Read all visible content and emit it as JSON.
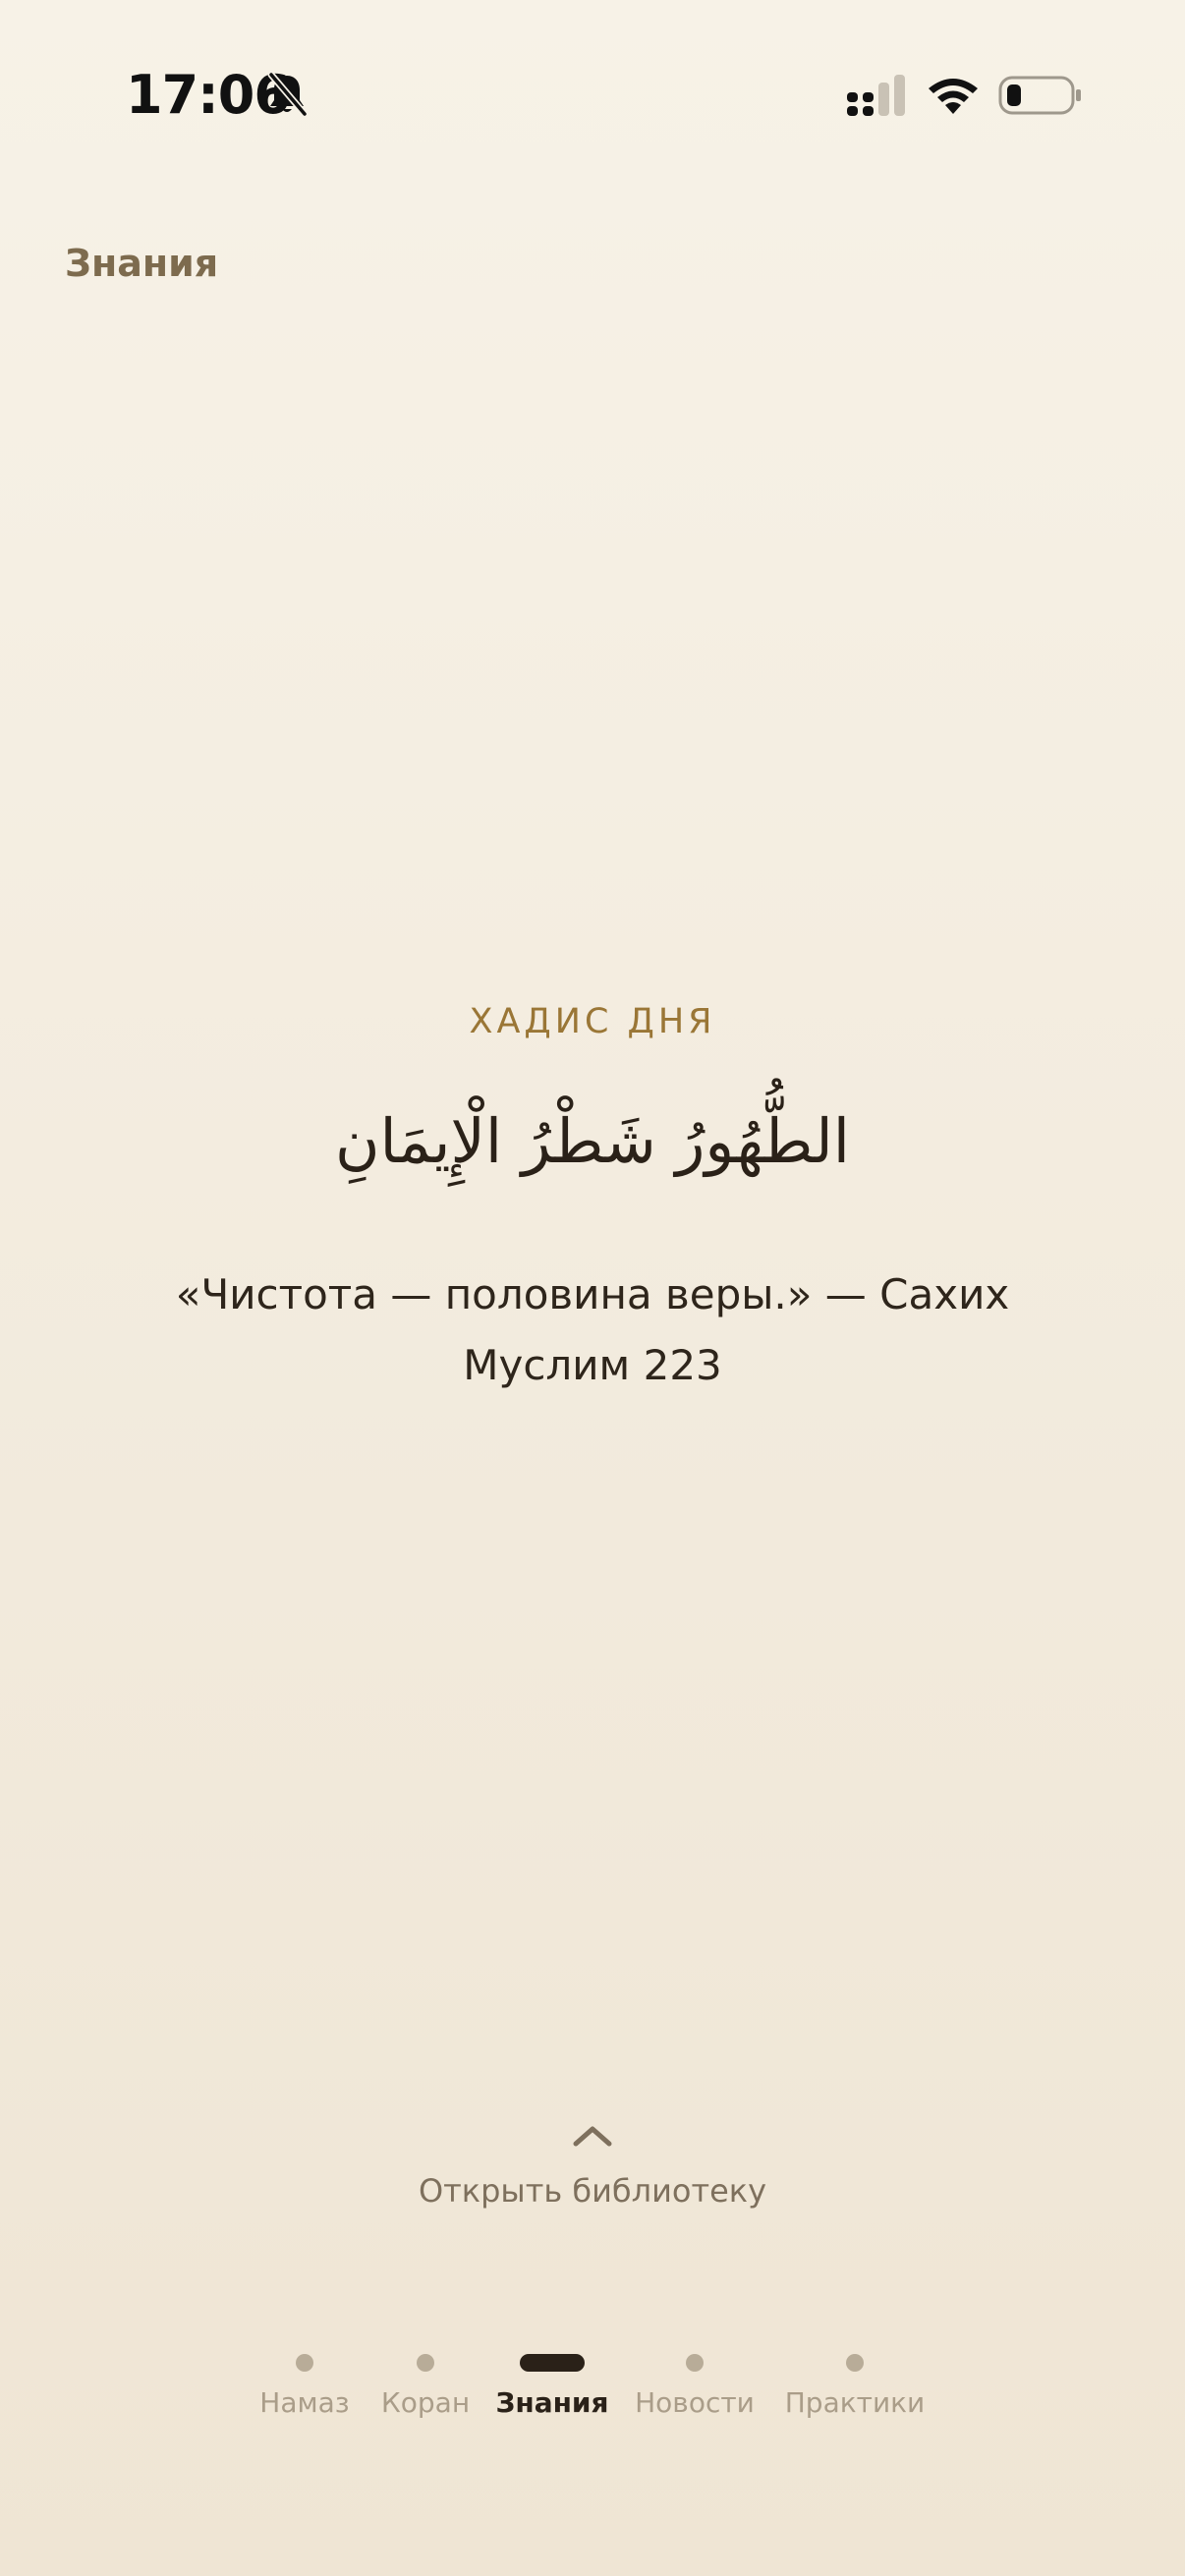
{
  "status_bar": {
    "time": "17:06",
    "silent_icon": "bell-slash-icon",
    "cellular_icon": "cellular-signal-icon",
    "wifi_icon": "wifi-icon",
    "battery_icon": "battery-low-icon"
  },
  "header": {
    "title": "Знания"
  },
  "hadith": {
    "label": "ХАДИС ДНЯ",
    "arabic": "الطُّهُورُ شَطْرُ الْإِيمَانِ",
    "translation": "«Чистота — половина веры.» — Сахих Муслим 223"
  },
  "library": {
    "icon": "chevron-up-icon",
    "label": "Открыть библиотеку"
  },
  "bottom_nav": {
    "items": [
      {
        "label": "Намаз",
        "active": false
      },
      {
        "label": "Коран",
        "active": false
      },
      {
        "label": "Знания",
        "active": true
      },
      {
        "label": "Новости",
        "active": false
      },
      {
        "label": "Практики",
        "active": false
      }
    ]
  },
  "colors": {
    "background": "#f5efe3",
    "accent_gold": "#9a7636",
    "header_text": "#7d6b4e",
    "primary_text": "#2a2118",
    "inactive_nav": "#aa9d89"
  }
}
